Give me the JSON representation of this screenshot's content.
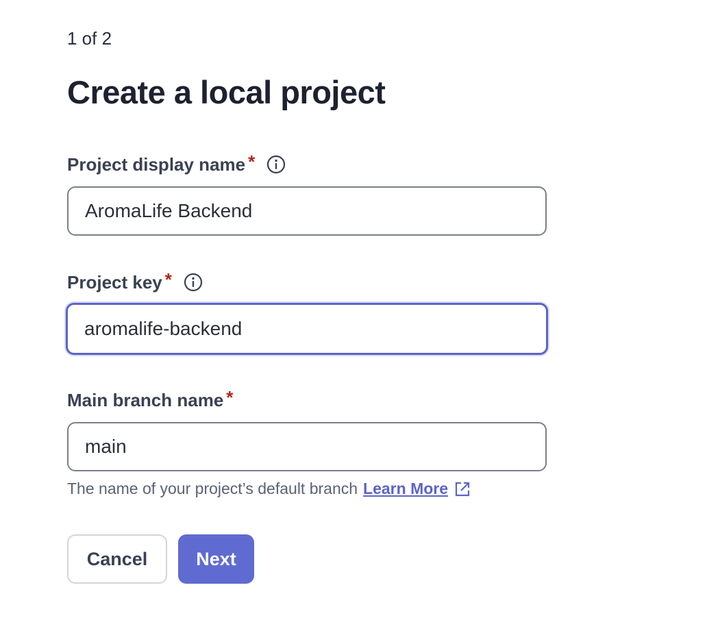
{
  "wizard": {
    "step_indicator": "1 of 2",
    "title": "Create a local project"
  },
  "form": {
    "display_name": {
      "label": "Project display name",
      "required_mark": "*",
      "value": "AromaLife Backend"
    },
    "project_key": {
      "label": "Project key",
      "required_mark": "*",
      "value": "aromalife-backend"
    },
    "main_branch": {
      "label": "Main branch name",
      "required_mark": "*",
      "value": "main",
      "helper_text": "The name of your project’s default branch",
      "learn_more_label": "Learn More"
    }
  },
  "actions": {
    "cancel_label": "Cancel",
    "next_label": "Next"
  },
  "colors": {
    "accent": "#5f6bd0",
    "required": "#b1251c",
    "focus_border": "#5c64c7"
  },
  "icons": {
    "info": "info-circle-icon",
    "external_link": "external-link-icon"
  }
}
